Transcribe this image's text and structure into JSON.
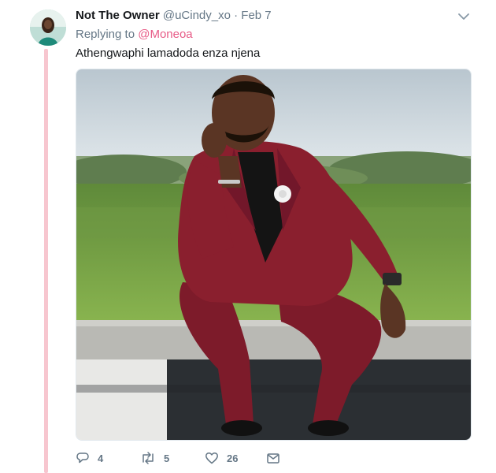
{
  "tweet": {
    "author_name": "Not The Owner",
    "handle": "@uCindy_xo",
    "separator": "·",
    "date": "Feb 7",
    "replying_prefix": "Replying to",
    "replying_to": "@Moneoa",
    "text": "Athengwaphi lamadoda enza njena"
  },
  "actions": {
    "reply_count": "4",
    "retweet_count": "5",
    "like_count": "26"
  },
  "icons": {
    "reply": "reply-icon",
    "retweet": "retweet-icon",
    "like": "heart-icon",
    "dm": "envelope-icon",
    "menu": "chevron-down-icon"
  },
  "colors": {
    "thread_line": "#f7c6cf",
    "mention": "#e0245e",
    "muted": "#657786",
    "suit": "#8a1f2e"
  }
}
